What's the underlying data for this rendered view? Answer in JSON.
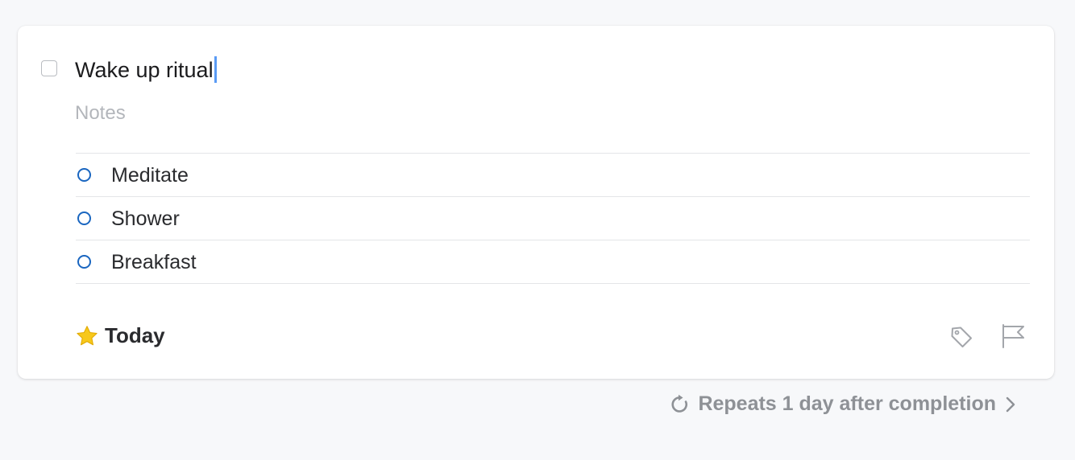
{
  "task": {
    "title": "Wake up ritual",
    "notes_placeholder": "Notes",
    "completed": false
  },
  "checklist": {
    "items": [
      {
        "label": "Meditate"
      },
      {
        "label": "Shower"
      },
      {
        "label": "Breakfast"
      }
    ]
  },
  "when": {
    "label": "Today",
    "icon": "star-icon"
  },
  "actions": {
    "tag_icon": "tag-icon",
    "flag_icon": "flag-icon"
  },
  "repeat": {
    "label": "Repeats 1 day after completion",
    "icon": "repeat-icon"
  },
  "colors": {
    "accent": "#1a66c0",
    "caret": "#5a9bf5",
    "star": "#f7c81b",
    "background": "#f7f8fa"
  }
}
